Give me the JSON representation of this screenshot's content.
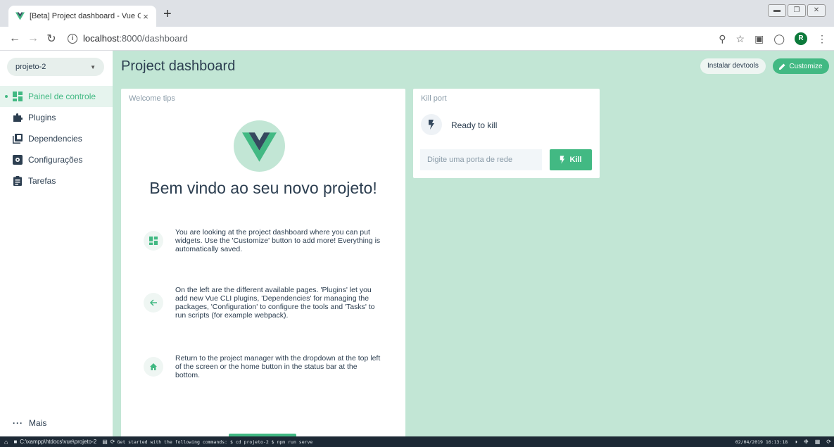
{
  "browser": {
    "tab_title": "[Beta] Project dashboard - Vue C",
    "tab_close": "×",
    "new_tab": "+",
    "url_host": "localhost",
    "url_path": ":8000/dashboard",
    "profile_initial": "R"
  },
  "sidebar": {
    "project": "projeto-2",
    "items": [
      {
        "label": "Painel de controle",
        "icon": "dashboard-icon",
        "active": true
      },
      {
        "label": "Plugins",
        "icon": "puzzle-icon"
      },
      {
        "label": "Dependencies",
        "icon": "library-icon"
      },
      {
        "label": "Configurações",
        "icon": "settings-app-icon"
      },
      {
        "label": "Tarefas",
        "icon": "clipboard-icon"
      }
    ],
    "more": "Mais"
  },
  "header": {
    "title": "Project dashboard",
    "devtools": "Instalar devtools",
    "customize": "Customize"
  },
  "welcome": {
    "title": "Welcome tips",
    "heading": "Bem vindo ao seu novo projeto!",
    "tips": [
      "You are looking at the project dashboard where you can put widgets. Use the 'Customize' button to add more! Everything is automatically saved.",
      "On the left are the different available pages. 'Plugins' let you add new Vue CLI plugins, 'Dependencies' for managing the packages, 'Configuration' to configure the tools and 'Tasks' to run scripts (for example webpack).",
      "Return to the project manager with the dropdown at the top left of the screen or the home button in the status bar at the bottom."
    ]
  },
  "killport": {
    "title": "Kill port",
    "status": "Ready to kill",
    "placeholder": "Digite uma porta de rede",
    "button": "Kill"
  },
  "statusbar": {
    "path": "C:\\xampp\\htdocs\\vue\\projeto-2",
    "message": "Get started with the following commands: $ cd projeto-2 $ npm run serve",
    "datetime": "02/04/2019 16:13:18"
  },
  "colors": {
    "accent": "#42b983",
    "main_bg": "#c2e6d5",
    "dark": "#2c3e50",
    "vue_dark": "#35495e"
  }
}
